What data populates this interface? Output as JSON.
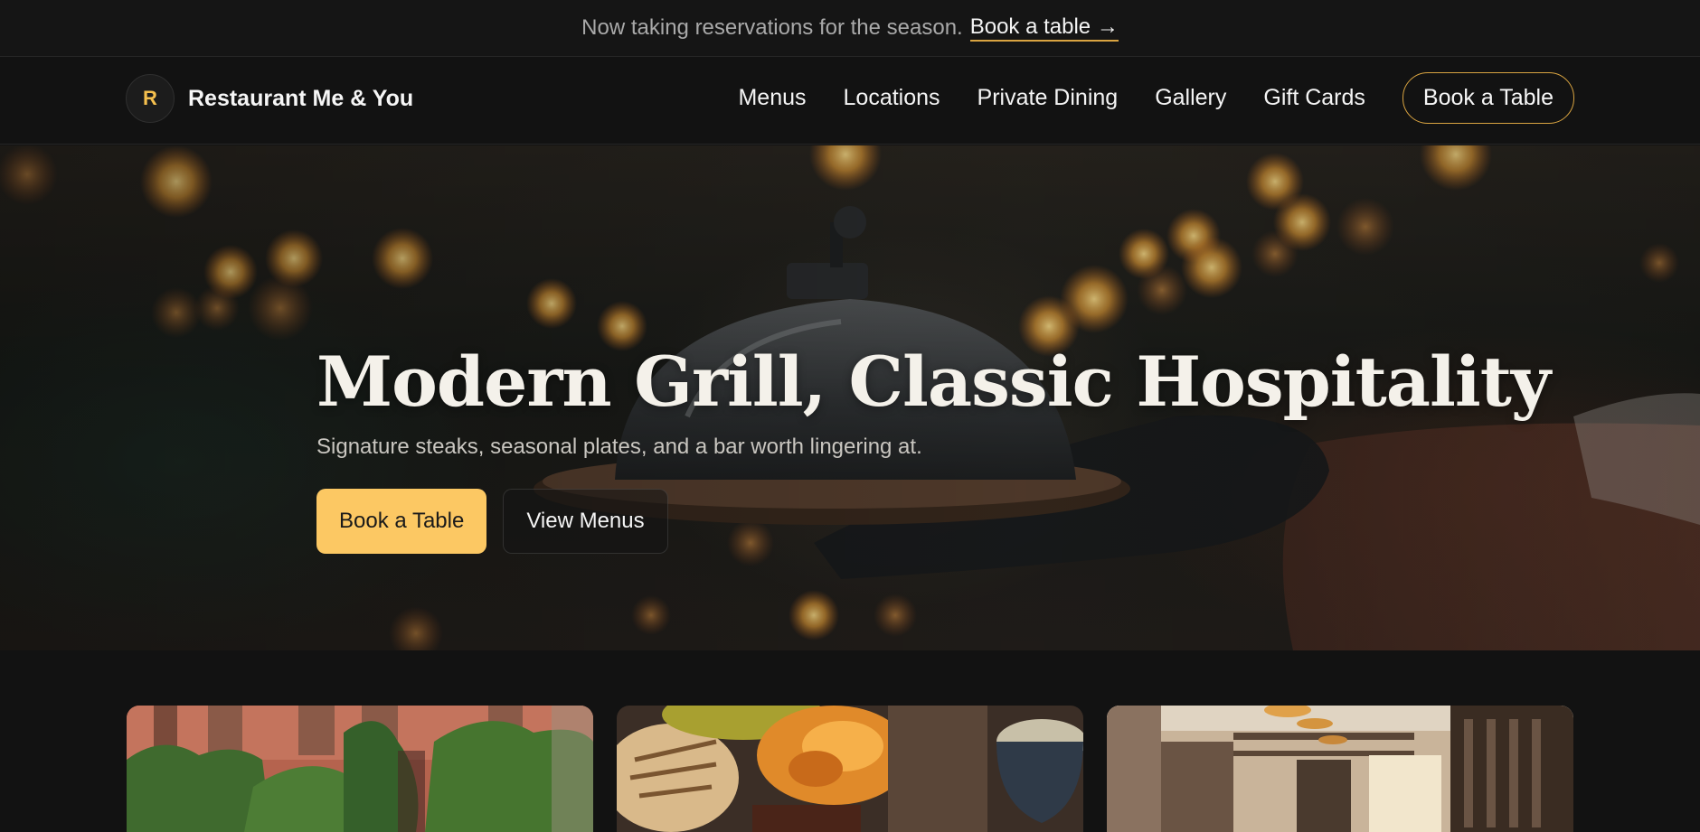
{
  "announcement": {
    "message": "Now taking reservations for the season.",
    "link_label": "Book a table →"
  },
  "header": {
    "brand_initial": "R",
    "brand_name": "Restaurant Me & You",
    "nav": [
      {
        "label": "Menus"
      },
      {
        "label": "Locations"
      },
      {
        "label": "Private Dining"
      },
      {
        "label": "Gallery"
      },
      {
        "label": "Gift Cards"
      }
    ],
    "cta_label": "Book a Table"
  },
  "hero": {
    "title": "Modern Grill, Classic Hospitality",
    "subtitle": "Signature steaks, seasonal plates, and a bar worth lingering at.",
    "primary_button": "Book a Table",
    "secondary_button": "View Menus"
  },
  "cards": [
    {
      "image": "ivy-covered-building-photo"
    },
    {
      "image": "grilled-dishes-photo"
    },
    {
      "image": "dining-room-interior-photo"
    }
  ],
  "colors": {
    "accent": "#fcc863",
    "accent_outline": "#d9a441",
    "background": "#121212"
  }
}
